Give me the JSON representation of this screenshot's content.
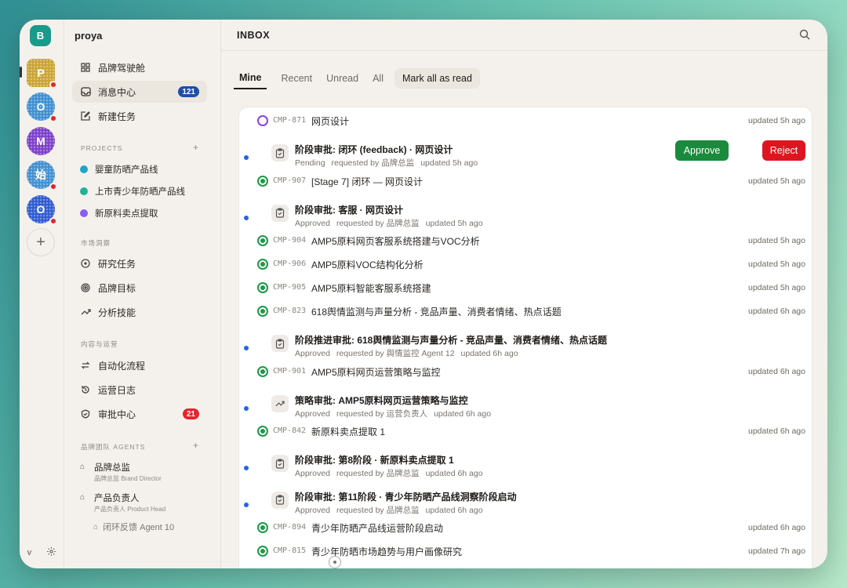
{
  "workspace": {
    "main_initial": "B"
  },
  "workspaces": [
    {
      "initial": "P",
      "color": "#c9a433",
      "has_alert": true,
      "shape": "sq"
    },
    {
      "initial": "O",
      "color": "#3f8fd1",
      "has_alert": true,
      "shape": "round"
    },
    {
      "initial": "M",
      "color": "#7b3fc9",
      "has_alert": false,
      "shape": "round"
    },
    {
      "initial": "始",
      "color": "#3f8fd1",
      "has_alert": true,
      "shape": "round"
    },
    {
      "initial": "O",
      "color": "#2f5bd1",
      "has_alert": true,
      "shape": "round"
    }
  ],
  "rail_footer": {
    "version": "v"
  },
  "sidebar": {
    "org_name": "proya",
    "nav": [
      {
        "label": "品牌驾驶舱",
        "icon": "grid-icon"
      },
      {
        "label": "消息中心",
        "icon": "inbox-icon",
        "badge": "121",
        "badge_color": "blue",
        "active": true
      },
      {
        "label": "新建任务",
        "icon": "edit-icon"
      }
    ],
    "projects_header": "PROJECTS",
    "projects": [
      {
        "label": "婴童防晒产品线",
        "color": "#1ca6c9"
      },
      {
        "label": "上市青少年防晒产品线",
        "color": "#1fb39a"
      },
      {
        "label": "新原料卖点提取",
        "color": "#8b5cf6"
      }
    ],
    "market_header": "市场洞察",
    "market": [
      {
        "label": "研究任务",
        "icon": "target-icon"
      },
      {
        "label": "品牌目标",
        "icon": "bullseye-icon"
      },
      {
        "label": "分析技能",
        "icon": "trend-icon"
      }
    ],
    "content_header": "内容与运营",
    "content": [
      {
        "label": "自动化流程",
        "icon": "repeat-icon"
      },
      {
        "label": "运营日志",
        "icon": "history-icon"
      },
      {
        "label": "审批中心",
        "icon": "shield-icon",
        "badge": "21",
        "badge_color": "red"
      }
    ],
    "agents_header": "品牌团队 AGENTS",
    "agents": [
      {
        "name": "品牌总监",
        "sub": "品牌总监 Brand Director"
      },
      {
        "name": "产品负责人",
        "sub": "产品负责人 Product Head"
      }
    ],
    "agent_child": "闭环反馈 Agent 10"
  },
  "header": {
    "title": "INBOX"
  },
  "tabs": [
    {
      "label": "Mine",
      "active": true
    },
    {
      "label": "Recent"
    },
    {
      "label": "Unread"
    },
    {
      "label": "All"
    }
  ],
  "mark_all_label": "Mark all as read",
  "buttons": {
    "approve": "Approve",
    "reject": "Reject"
  },
  "items": [
    {
      "kind": "issue",
      "status": "open",
      "id": "CMP-871",
      "title": "网页设计",
      "updated": "updated 5h ago"
    },
    {
      "kind": "approval",
      "title": "阶段审批: 闭环 (feedback) · 网页设计",
      "state": "Pending",
      "requested": "requested by 品牌总监",
      "updated": "updated 5h ago",
      "actions": true,
      "icon": "clipboard-icon"
    },
    {
      "kind": "issue",
      "status": "done",
      "id": "CMP-907",
      "title": "[Stage 7] 闭环 — 网页设计",
      "updated": "updated 5h ago"
    },
    {
      "kind": "approval",
      "title": "阶段审批: 客服 · 网页设计",
      "state": "Approved",
      "requested": "requested by 品牌总监",
      "updated": "updated 5h ago",
      "icon": "clipboard-icon"
    },
    {
      "kind": "issue",
      "status": "done",
      "id": "CMP-904",
      "title": "AMP5原料网页客服系统搭建与VOC分析",
      "updated": "updated 5h ago"
    },
    {
      "kind": "issue",
      "status": "done",
      "id": "CMP-906",
      "title": "AMP5原料VOC结构化分析",
      "updated": "updated 5h ago"
    },
    {
      "kind": "issue",
      "status": "done",
      "id": "CMP-905",
      "title": "AMP5原料智能客服系统搭建",
      "updated": "updated 5h ago"
    },
    {
      "kind": "issue",
      "status": "done",
      "id": "CMP-823",
      "title": "618舆情监测与声量分析 - 竞品声量、消费者情绪、热点话题",
      "updated": "updated 6h ago"
    },
    {
      "kind": "approval",
      "title": "阶段推进审批: 618舆情监测与声量分析 - 竞品声量、消费者情绪、热点话题",
      "state": "Approved",
      "requested": "requested by 舆情监控 Agent 12",
      "updated": "updated 6h ago",
      "icon": "clipboard-icon"
    },
    {
      "kind": "issue",
      "status": "done",
      "id": "CMP-901",
      "title": "AMP5原料网页运营策略与监控",
      "updated": "updated 6h ago"
    },
    {
      "kind": "approval",
      "title": "策略审批: AMP5原料网页运营策略与监控",
      "state": "Approved",
      "requested": "requested by 运营负责人",
      "updated": "updated 6h ago",
      "icon": "trend-icon"
    },
    {
      "kind": "issue",
      "status": "done",
      "id": "CMP-842",
      "title": "新原料卖点提取 1",
      "updated": "updated 6h ago"
    },
    {
      "kind": "approval",
      "title": "阶段审批: 第8阶段 · 新原料卖点提取 1",
      "state": "Approved",
      "requested": "requested by 品牌总监",
      "updated": "updated 6h ago",
      "icon": "clipboard-icon"
    },
    {
      "kind": "approval",
      "title": "阶段审批: 第11阶段 · 青少年防晒产品线洞察阶段启动",
      "state": "Approved",
      "requested": "requested by 品牌总监",
      "updated": "updated 6h ago",
      "icon": "clipboard-icon"
    },
    {
      "kind": "issue",
      "status": "done",
      "id": "CMP-894",
      "title": "青少年防晒产品线运营阶段启动",
      "updated": "updated 6h ago"
    },
    {
      "kind": "issue",
      "status": "done",
      "id": "CMP-815",
      "title": "青少年防晒市场趋势与用户画像研究",
      "updated": "updated 7h ago"
    }
  ]
}
